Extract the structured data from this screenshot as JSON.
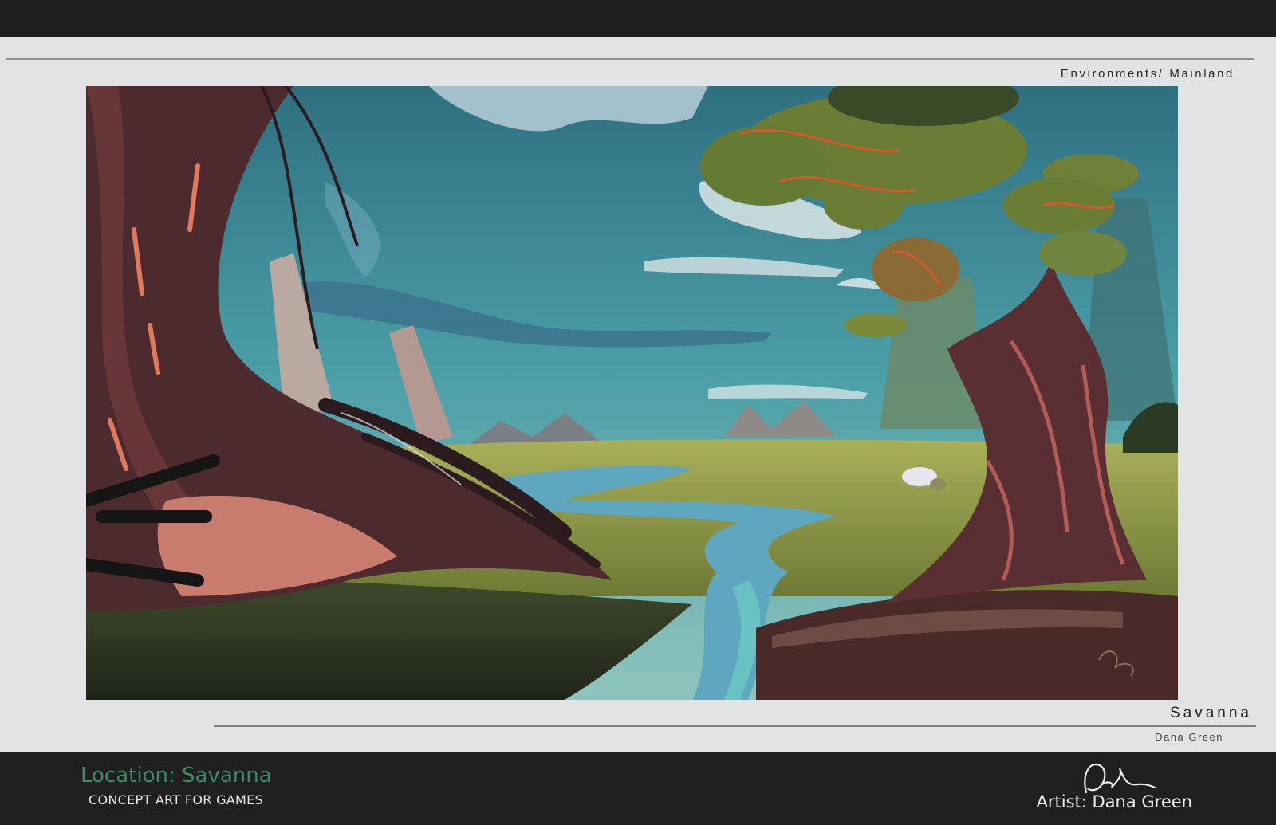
{
  "header": {
    "category": "Environments/ Mainland"
  },
  "artwork": {
    "title": "Savanna",
    "artist": "Dana Green"
  },
  "footer": {
    "location": "Location: Savanna",
    "subtitle": "CONCEPT ART FOR GAMES",
    "artist_credit": "Artist: Dana Green"
  },
  "colors": {
    "sheet": "#e2e3e5",
    "dark_band": "#1f1f1f",
    "location_green": "#3f8a67",
    "sky": "#4c97a0",
    "trunk": "#5a2f33",
    "foliage": "#6b7d34"
  }
}
